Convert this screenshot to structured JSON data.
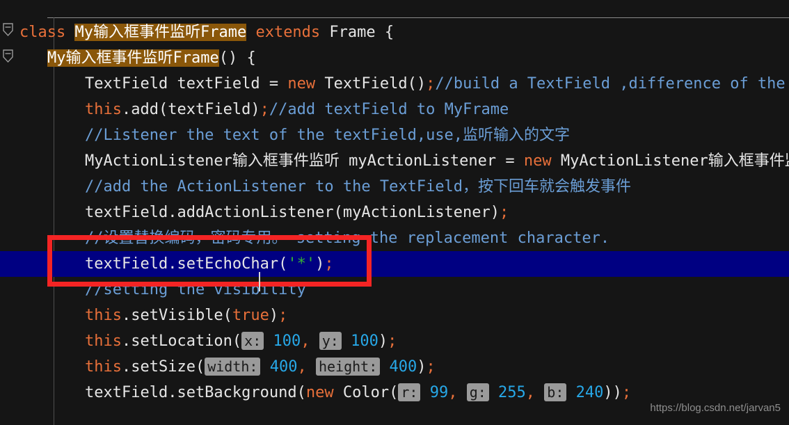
{
  "editor": {
    "background_color": "#151515",
    "selection_color": "#000082",
    "annotation_color": "#f42424",
    "occurrence_highlight_color": "#8a570a",
    "watermark": "https://blog.csdn.net/jarvan5"
  },
  "gutter": {
    "fold_markers": [
      {
        "name": "fold-marker-class",
        "state": "expanded"
      },
      {
        "name": "fold-marker-constructor",
        "state": "expanded"
      }
    ]
  },
  "code": {
    "lines": [
      {
        "id": "line-class-decl",
        "tokens": [
          {
            "t": "class ",
            "c": "kw"
          },
          {
            "t": "My输入框事件监听Frame",
            "c": "hl"
          },
          {
            "t": " ",
            "c": "plain"
          },
          {
            "t": "extends",
            "c": "kw"
          },
          {
            "t": " Frame {",
            "c": "plain"
          }
        ]
      },
      {
        "id": "line-constructor",
        "tokens": [
          {
            "t": "My输入框事件监听Frame",
            "c": "hl"
          },
          {
            "t": "() {",
            "c": "plain"
          }
        ]
      },
      {
        "id": "line-textfield-decl",
        "tokens": [
          {
            "t": "TextField textField = ",
            "c": "plain"
          },
          {
            "t": "new",
            "c": "kw"
          },
          {
            "t": " TextField()",
            "c": "plain"
          },
          {
            "t": ";",
            "c": "punct"
          },
          {
            "t": "//build a TextField ,difference of the TextArea",
            "c": "cmt"
          }
        ]
      },
      {
        "id": "line-add-textfield",
        "tokens": [
          {
            "t": "this",
            "c": "kw"
          },
          {
            "t": ".add(textField)",
            "c": "plain"
          },
          {
            "t": ";",
            "c": "punct"
          },
          {
            "t": "//add textField to MyFrame",
            "c": "cmt"
          }
        ]
      },
      {
        "id": "line-comment-listener",
        "tokens": [
          {
            "t": "//Listener the text of the textField,use,监听输入的文字",
            "c": "cmt"
          }
        ]
      },
      {
        "id": "line-listener-decl",
        "tokens": [
          {
            "t": "MyActionListener输入框事件监听 myActionListener = ",
            "c": "plain"
          },
          {
            "t": "new",
            "c": "kw"
          },
          {
            "t": " MyActionListener输入框事件监听();",
            "c": "plain"
          }
        ]
      },
      {
        "id": "line-comment-add-listener",
        "tokens": [
          {
            "t": "//add the ActionListener to the TextField，按下回车就会触发事件",
            "c": "cmt"
          }
        ]
      },
      {
        "id": "line-add-action-listener",
        "tokens": [
          {
            "t": "textField.addActionListener(myActionListener)",
            "c": "plain"
          },
          {
            "t": ";",
            "c": "punct"
          }
        ]
      },
      {
        "id": "line-comment-echo",
        "tokens": [
          {
            "t": "//设置替换编码，密码专用。 setting the replacement character.",
            "c": "cmt"
          }
        ]
      },
      {
        "id": "line-set-echo-char",
        "selected": true,
        "tokens": [
          {
            "t": "textField.setEchoChar(",
            "c": "plain"
          },
          {
            "t": "'*'",
            "c": "chr"
          },
          {
            "t": ")",
            "c": "plain"
          },
          {
            "t": ";",
            "c": "punct"
          }
        ]
      },
      {
        "id": "line-comment-visibility",
        "tokens": [
          {
            "t": "//setting the visibility",
            "c": "cmt"
          }
        ]
      },
      {
        "id": "line-set-visible",
        "tokens": [
          {
            "t": "this",
            "c": "kw"
          },
          {
            "t": ".setVisible(",
            "c": "plain"
          },
          {
            "t": "true",
            "c": "kw"
          },
          {
            "t": ")",
            "c": "plain"
          },
          {
            "t": ";",
            "c": "punct"
          }
        ]
      },
      {
        "id": "line-set-location",
        "tokens": [
          {
            "t": "this",
            "c": "kw"
          },
          {
            "t": ".setLocation(",
            "c": "plain"
          },
          {
            "t": "x:",
            "c": "hint"
          },
          {
            "t": " ",
            "c": "plain"
          },
          {
            "t": "100",
            "c": "num"
          },
          {
            "t": ",",
            "c": "punct"
          },
          {
            "t": " ",
            "c": "plain"
          },
          {
            "t": "y:",
            "c": "hint"
          },
          {
            "t": " ",
            "c": "plain"
          },
          {
            "t": "100",
            "c": "num"
          },
          {
            "t": ")",
            "c": "plain"
          },
          {
            "t": ";",
            "c": "punct"
          }
        ]
      },
      {
        "id": "line-set-size",
        "tokens": [
          {
            "t": "this",
            "c": "kw"
          },
          {
            "t": ".setSize(",
            "c": "plain"
          },
          {
            "t": "width:",
            "c": "hint"
          },
          {
            "t": " ",
            "c": "plain"
          },
          {
            "t": "400",
            "c": "num"
          },
          {
            "t": ",",
            "c": "punct"
          },
          {
            "t": " ",
            "c": "plain"
          },
          {
            "t": "height:",
            "c": "hint"
          },
          {
            "t": " ",
            "c": "plain"
          },
          {
            "t": "400",
            "c": "num"
          },
          {
            "t": ")",
            "c": "plain"
          },
          {
            "t": ";",
            "c": "punct"
          }
        ]
      },
      {
        "id": "line-set-background",
        "tokens": [
          {
            "t": "textField.setBackground(",
            "c": "plain"
          },
          {
            "t": "new",
            "c": "kw"
          },
          {
            "t": " Color(",
            "c": "plain"
          },
          {
            "t": "r:",
            "c": "hint"
          },
          {
            "t": " ",
            "c": "plain"
          },
          {
            "t": "99",
            "c": "num"
          },
          {
            "t": ",",
            "c": "punct"
          },
          {
            "t": " ",
            "c": "plain"
          },
          {
            "t": "g:",
            "c": "hint"
          },
          {
            "t": " ",
            "c": "plain"
          },
          {
            "t": "255",
            "c": "num"
          },
          {
            "t": ",",
            "c": "punct"
          },
          {
            "t": " ",
            "c": "plain"
          },
          {
            "t": "b:",
            "c": "hint"
          },
          {
            "t": " ",
            "c": "plain"
          },
          {
            "t": "240",
            "c": "num"
          },
          {
            "t": "))",
            "c": "plain"
          },
          {
            "t": ";",
            "c": "punct"
          }
        ]
      }
    ]
  }
}
